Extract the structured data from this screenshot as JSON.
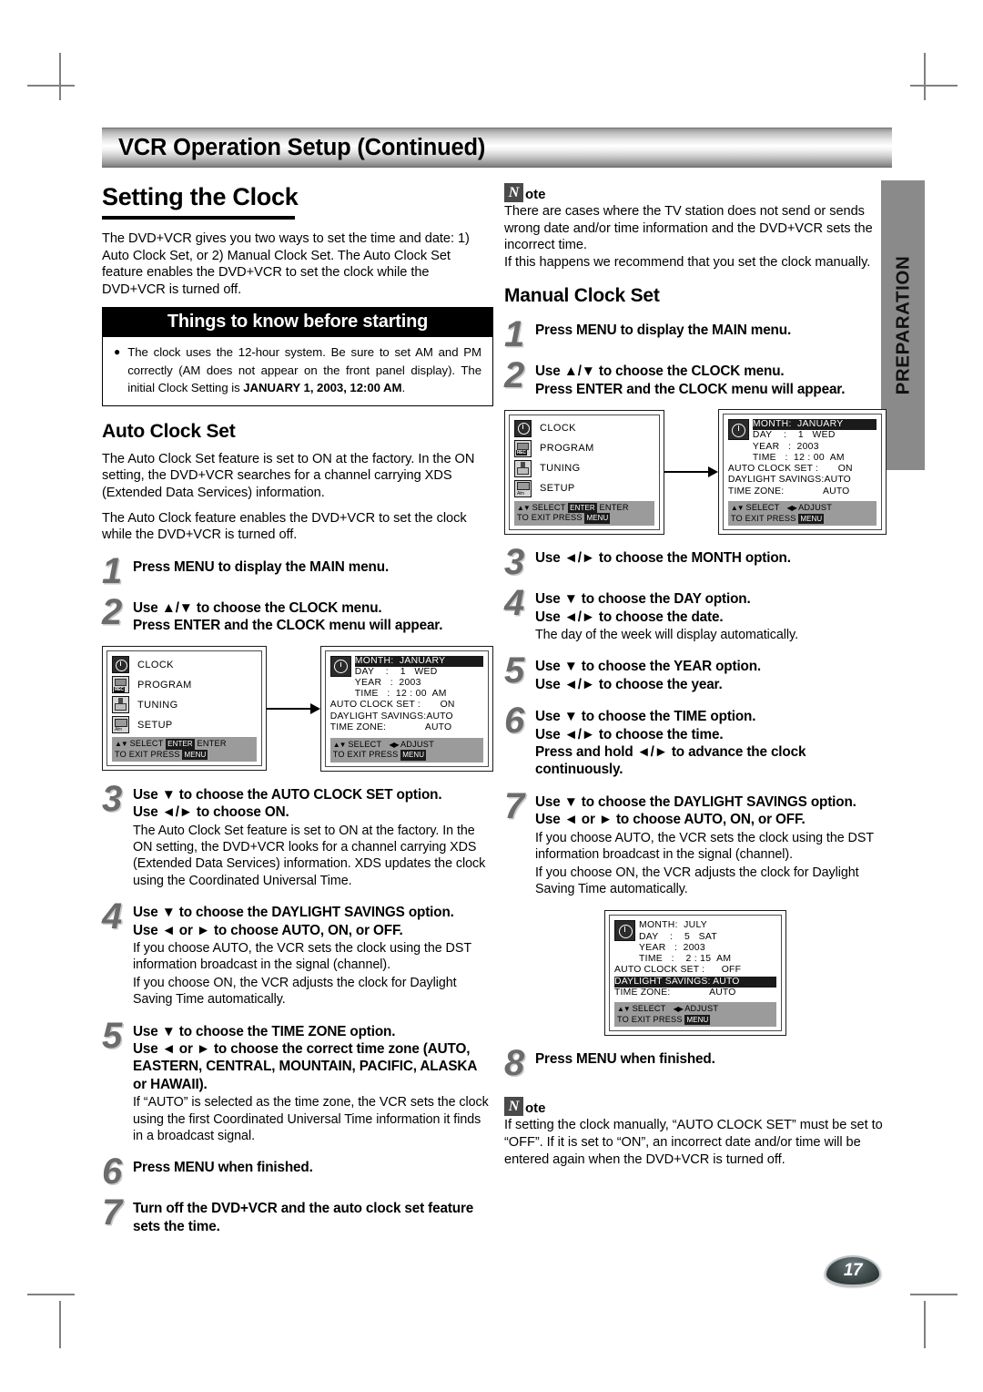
{
  "header": {
    "chapter_title": "VCR Operation Setup (Continued)"
  },
  "side_tab": {
    "label": "PREPARATION"
  },
  "page_number": "17",
  "left": {
    "section_title": "Setting the Clock",
    "intro": "The DVD+VCR gives you two ways to set the time and date: 1) Auto Clock Set, or 2) Manual Clock Set. The Auto Clock Set feature enables the DVD+VCR to set the clock while the DVD+VCR is turned off.",
    "things_box": {
      "heading": "Things to know before starting",
      "bullet_pre": "The clock uses the 12-hour system. Be sure to set AM and PM correctly (AM does not appear on the front panel display). The initial Clock Setting is ",
      "bullet_bold": "JANUARY 1, 2003, 12:00 AM",
      "bullet_post": "."
    },
    "auto_heading": "Auto Clock Set",
    "auto_intro_1": "The Auto Clock Set feature is set to ON at the factory. In the ON setting, the DVD+VCR searches for a channel carrying XDS (Extended Data Services) information.",
    "auto_intro_2": "The Auto Clock feature enables the DVD+VCR to set the clock while the DVD+VCR is turned off.",
    "steps": [
      {
        "num": "1",
        "bold": [
          "Press MENU to display the MAIN menu."
        ],
        "normal": []
      },
      {
        "num": "2",
        "bold": [
          "Use ▲/▼ to choose the CLOCK menu.",
          "Press ENTER and the CLOCK menu will appear."
        ],
        "normal": []
      },
      {
        "num": "3",
        "bold": [
          "Use ▼ to choose the AUTO CLOCK SET option.",
          "Use ◄/► to choose ON."
        ],
        "normal": [
          "The Auto Clock Set feature is set to ON at the factory. In the ON setting, the DVD+VCR looks for a channel carrying XDS (Extended Data Services) information. XDS updates the clock using the Coordinated Universal Time."
        ]
      },
      {
        "num": "4",
        "bold": [
          "Use ▼ to choose the DAYLIGHT SAVINGS option.",
          "Use ◄ or ► to choose AUTO, ON, or OFF."
        ],
        "normal": [
          "If you choose AUTO, the VCR sets the clock using the DST information broadcast in the signal (channel).",
          "If you choose ON, the VCR adjusts the clock for Daylight Saving Time automatically."
        ]
      },
      {
        "num": "5",
        "bold": [
          "Use ▼ to choose the TIME ZONE option.",
          "Use ◄ or ► to choose the correct time zone (AUTO, EASTERN, CENTRAL, MOUNTAIN, PACIFIC, ALASKA or HAWAII)."
        ],
        "normal": [
          "If “AUTO” is selected as the time zone, the VCR sets the clock using the first Coordinated Universal Time information it finds in a broadcast signal."
        ]
      },
      {
        "num": "6",
        "bold": [
          "Press MENU when finished."
        ],
        "normal": []
      },
      {
        "num": "7",
        "bold": [
          "Turn off the DVD+VCR and the auto clock set feature sets the time."
        ],
        "normal": []
      }
    ]
  },
  "right": {
    "note_top": {
      "n": "N",
      "ote": "ote",
      "lines": [
        "There are cases where the TV station does not send or sends wrong date and/or time information and the DVD+VCR sets the incorrect time.",
        "If this happens we recommend that you set the clock manually."
      ]
    },
    "manual_heading": "Manual Clock Set",
    "steps": [
      {
        "num": "1",
        "bold": [
          "Press MENU to display the MAIN menu."
        ],
        "normal": []
      },
      {
        "num": "2",
        "bold": [
          "Use ▲/▼ to choose the CLOCK menu.",
          "Press ENTER and the CLOCK menu will appear."
        ],
        "normal": []
      },
      {
        "num": "3",
        "bold": [
          "Use ◄/► to choose the MONTH option."
        ],
        "normal": []
      },
      {
        "num": "4",
        "bold": [
          "Use ▼ to choose the DAY option.",
          "Use ◄/► to choose the date."
        ],
        "normal": [
          "The day of the week will display automatically."
        ]
      },
      {
        "num": "5",
        "bold": [
          "Use ▼ to choose the YEAR option.",
          "Use ◄/► to choose the year."
        ],
        "normal": []
      },
      {
        "num": "6",
        "bold": [
          "Use ▼ to choose the TIME option.",
          "Use ◄/► to choose the time.",
          "Press and hold ◄/► to advance the clock continuously."
        ],
        "normal": []
      },
      {
        "num": "7",
        "bold": [
          "Use ▼ to choose the DAYLIGHT SAVINGS option.",
          "Use ◄ or ► to choose AUTO, ON, or OFF."
        ],
        "normal": [
          "If you choose AUTO, the VCR sets the clock using the DST information broadcast in the signal (channel).",
          "If you choose ON, the VCR adjusts the clock for Daylight Saving Time automatically."
        ]
      },
      {
        "num": "8",
        "bold": [
          "Press MENU when finished."
        ],
        "normal": []
      }
    ],
    "note_bottom": {
      "n": "N",
      "ote": "ote",
      "lines": [
        "If setting the clock manually, “AUTO CLOCK SET” must be set to “OFF”. If it is set to “ON”, an incorrect date and/or time will be entered again when the DVD+VCR is turned off."
      ]
    }
  },
  "osd": {
    "main_menu": {
      "items": [
        {
          "icon": "clock-icon",
          "label": "CLOCK"
        },
        {
          "icon": "rec-icon",
          "label": "PROGRAM"
        },
        {
          "icon": "tuning-icon",
          "label": "TUNING"
        },
        {
          "icon": "setup-icon",
          "label": "SETUP"
        }
      ],
      "footer_line1_a": "SELECT",
      "footer_key": "ENTER",
      "footer_line1_b": "ENTER",
      "footer_line2_a": "TO  EXIT  PRESS",
      "footer_key2": "MENU"
    },
    "clock_menu_default": {
      "rows": [
        {
          "text": "MONTH:  JANUARY",
          "highlight": true,
          "wide": false
        },
        {
          "text": "DAY    :    1   WED",
          "highlight": false,
          "wide": false
        },
        {
          "text": "YEAR   :  2003",
          "highlight": false,
          "wide": false
        },
        {
          "text": "TIME   :  12 : 00  AM",
          "highlight": false,
          "wide": false
        }
      ],
      "wide_rows": [
        {
          "text": "AUTO CLOCK SET :       ON",
          "highlight": false
        },
        {
          "text": "DAYLIGHT SAVINGS:AUTO",
          "highlight": false
        },
        {
          "text": "TIME ZONE:              AUTO",
          "highlight": false
        }
      ],
      "footer_select": "SELECT",
      "footer_adjust": "ADJUST",
      "footer_line2": "TO  EXIT  PRESS",
      "footer_key2": "MENU"
    },
    "clock_menu_manual": {
      "rows": [
        {
          "text": "MONTH:  JULY",
          "highlight": false,
          "wide": false
        },
        {
          "text": "DAY    :    5   SAT",
          "highlight": false,
          "wide": false
        },
        {
          "text": "YEAR   :  2003",
          "highlight": false,
          "wide": false
        },
        {
          "text": "TIME   :    2 : 15  AM",
          "highlight": false,
          "wide": false
        }
      ],
      "wide_rows": [
        {
          "text": "AUTO CLOCK SET :      OFF",
          "highlight": false
        },
        {
          "text": "DAYLIGHT SAVINGS: AUTO",
          "highlight": true
        },
        {
          "text": "TIME ZONE:              AUTO",
          "highlight": false
        }
      ],
      "footer_select": "SELECT",
      "footer_adjust": "ADJUST",
      "footer_line2": "TO  EXIT  PRESS",
      "footer_key2": "MENU"
    }
  }
}
